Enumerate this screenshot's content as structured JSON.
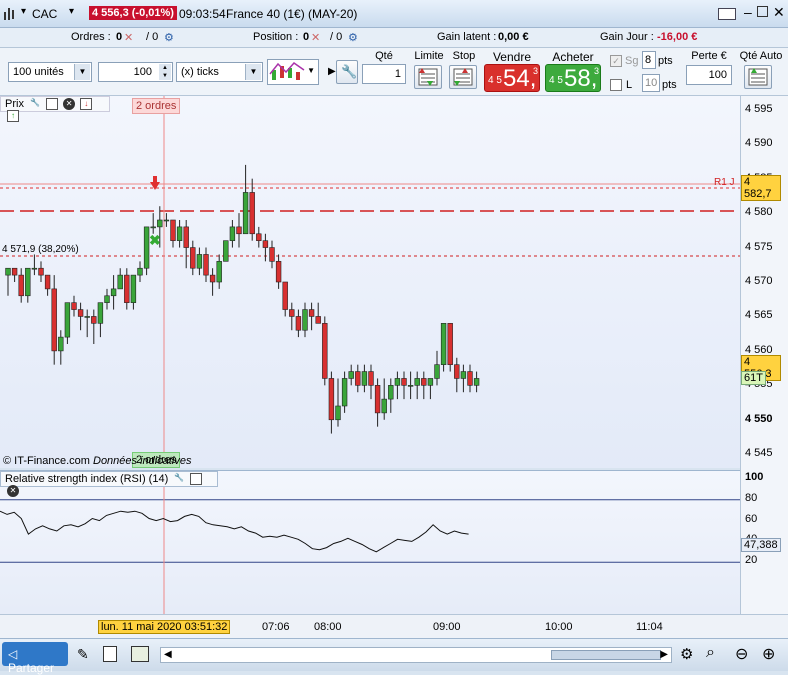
{
  "titlebar": {
    "symbol": "CAC",
    "price_badge": "4 556,3 (-0,01%)",
    "time": "09:03:54",
    "instrument": "France 40 (1€) (MAY-20)"
  },
  "infobar": {
    "orders_label": "Ordres :",
    "orders_value": "0",
    "orders_sep": "/ 0",
    "position_label": "Position :",
    "position_value": "0",
    "position_sep": "/ 0",
    "gain_latent_label": "Gain latent :",
    "gain_latent_value": "0,00 €",
    "gain_jour_label": "Gain Jour :",
    "gain_jour_value": "-16,00 €"
  },
  "order": {
    "units": "100 unités",
    "amount": "100",
    "ticks": "(x) ticks",
    "qty_label": "Qté",
    "qty_value": "1",
    "limite_label": "Limite",
    "stop_label": "Stop",
    "sell_label": "Vendre",
    "sell_small": "4 5",
    "sell_big": "54,",
    "sell_sup": "3",
    "buy_label": "Acheter",
    "buy_small": "4 5",
    "buy_big": "58,",
    "buy_sup": "3",
    "sg_label": "Sg",
    "sg_value": "8",
    "pts1": "pts",
    "l_label": "L",
    "l_value": "10",
    "pts2": "pts",
    "perte_label": "Perte €",
    "perte_value": "100",
    "qte_auto_label": "Qté Auto"
  },
  "chart": {
    "panel_label": "Prix",
    "orders_flag_top": "2 ordres",
    "orders_flag_bottom": "2 ordres",
    "fib_label": "4 571,9 (38,20%)",
    "r1_label": "R1 J",
    "copyright": "© IT-Finance.com",
    "data_note": "Données indicatives",
    "price_tag_r1": "4 582,7",
    "price_tag_last": "4 556,3",
    "timer_tag": "61T",
    "y_ticks": [
      "4 595",
      "4 590",
      "4 585",
      "4 580",
      "4 575",
      "4 570",
      "4 565",
      "4 560",
      "4 555",
      "4 550",
      "4 545"
    ]
  },
  "chart_data": {
    "type": "candlestick",
    "ylim": [
      4543,
      4597
    ],
    "candles": [
      [
        4571,
        4572,
        4568,
        4572
      ],
      [
        4572,
        4572,
        4570,
        4571
      ],
      [
        4571,
        4572,
        4567,
        4568
      ],
      [
        4568,
        4572,
        4567,
        4572
      ],
      [
        4572,
        4574,
        4571,
        4572
      ],
      [
        4572,
        4573,
        4570,
        4571
      ],
      [
        4571,
        4571,
        4568,
        4569
      ],
      [
        4569,
        4571,
        4558,
        4560
      ],
      [
        4560,
        4563,
        4558,
        4562
      ],
      [
        4562,
        4567,
        4561,
        4567
      ],
      [
        4567,
        4568,
        4565,
        4566
      ],
      [
        4566,
        4567,
        4563,
        4565
      ],
      [
        4565,
        4566,
        4562,
        4565
      ],
      [
        4565,
        4566,
        4561,
        4564
      ],
      [
        4564,
        4567,
        4562,
        4567
      ],
      [
        4567,
        4569,
        4566,
        4568
      ],
      [
        4568,
        4571,
        4566,
        4569
      ],
      [
        4569,
        4572,
        4569,
        4571
      ],
      [
        4571,
        4572,
        4566,
        4567
      ],
      [
        4567,
        4571,
        4566,
        4571
      ],
      [
        4571,
        4573,
        4570,
        4572
      ],
      [
        4572,
        4578,
        4571,
        4578
      ],
      [
        4578,
        4580,
        4577,
        4578
      ],
      [
        4578,
        4581,
        4575,
        4579
      ],
      [
        4579,
        4580,
        4578,
        4579
      ],
      [
        4579,
        4579,
        4575,
        4576
      ],
      [
        4576,
        4579,
        4575,
        4578
      ],
      [
        4578,
        4579,
        4572,
        4575
      ],
      [
        4575,
        4576,
        4571,
        4572
      ],
      [
        4572,
        4575,
        4571,
        4574
      ],
      [
        4574,
        4575,
        4570,
        4571
      ],
      [
        4571,
        4572,
        4568,
        4570
      ],
      [
        4570,
        4574,
        4569,
        4573
      ],
      [
        4573,
        4576,
        4573,
        4576
      ],
      [
        4576,
        4579,
        4575,
        4578
      ],
      [
        4578,
        4580,
        4575,
        4577
      ],
      [
        4577,
        4587,
        4577,
        4583
      ],
      [
        4583,
        4585,
        4576,
        4577
      ],
      [
        4577,
        4578,
        4575,
        4576
      ],
      [
        4576,
        4577,
        4573,
        4575
      ],
      [
        4575,
        4576,
        4572,
        4573
      ],
      [
        4573,
        4574,
        4569,
        4570
      ],
      [
        4570,
        4570,
        4565,
        4566
      ],
      [
        4566,
        4567,
        4563,
        4565
      ],
      [
        4565,
        4566,
        4562,
        4563
      ],
      [
        4563,
        4567,
        4562,
        4566
      ],
      [
        4566,
        4567,
        4563,
        4565
      ],
      [
        4565,
        4567,
        4564,
        4564
      ],
      [
        4564,
        4565,
        4555,
        4556
      ],
      [
        4556,
        4557,
        4548,
        4550
      ],
      [
        4550,
        4556,
        4549,
        4552
      ],
      [
        4552,
        4557,
        4551,
        4556
      ],
      [
        4556,
        4558,
        4555,
        4557
      ],
      [
        4557,
        4558,
        4554,
        4555
      ],
      [
        4555,
        4558,
        4554,
        4557
      ],
      [
        4557,
        4558,
        4553,
        4555
      ],
      [
        4555,
        4556,
        4549,
        4551
      ],
      [
        4551,
        4556,
        4550,
        4553
      ],
      [
        4553,
        4556,
        4551,
        4555
      ],
      [
        4555,
        4557,
        4553,
        4556
      ],
      [
        4556,
        4557,
        4553,
        4555
      ],
      [
        4555,
        4557,
        4553,
        4555
      ],
      [
        4555,
        4557,
        4553,
        4556
      ],
      [
        4556,
        4557,
        4553,
        4555
      ],
      [
        4555,
        4556,
        4553,
        4556
      ],
      [
        4556,
        4560,
        4555,
        4558
      ],
      [
        4558,
        4564,
        4557,
        4564
      ],
      [
        4564,
        4564,
        4557,
        4558
      ],
      [
        4558,
        4559,
        4554,
        4556
      ],
      [
        4556,
        4558,
        4554,
        4557
      ],
      [
        4557,
        4558,
        4554,
        4555
      ],
      [
        4555,
        4557,
        4554,
        4556
      ]
    ],
    "rsi_ticks": [
      "100",
      "80",
      "60",
      "40",
      "20"
    ],
    "rsi_value": "47,388",
    "rsi_ylim": [
      0,
      100
    ],
    "rsi_levels": [
      80,
      20
    ],
    "rsi_values": [
      69,
      66,
      68,
      62,
      47,
      52,
      55,
      52,
      50,
      55,
      56,
      54,
      57,
      62,
      60,
      65,
      67,
      69,
      68,
      69,
      67,
      62,
      60,
      62,
      59,
      60,
      64,
      66,
      64,
      58,
      56,
      55,
      54,
      52,
      54,
      50,
      48,
      44,
      45,
      44,
      46,
      44,
      42,
      38,
      33,
      32,
      34,
      38,
      40,
      43,
      40,
      37,
      33,
      30,
      34,
      38,
      42,
      41,
      40,
      44,
      49,
      56,
      50,
      47,
      50,
      48,
      47
    ]
  },
  "rsi_panel": {
    "label": "Relative strength index (RSI) (14)"
  },
  "xaxis": {
    "cursor_label": "lun. 11 mai 2020 03:51:32",
    "ticks": [
      "07:06",
      "08:00",
      "09:00",
      "10:00",
      "11:04"
    ]
  },
  "bottombar": {
    "share_label": "Partager"
  }
}
